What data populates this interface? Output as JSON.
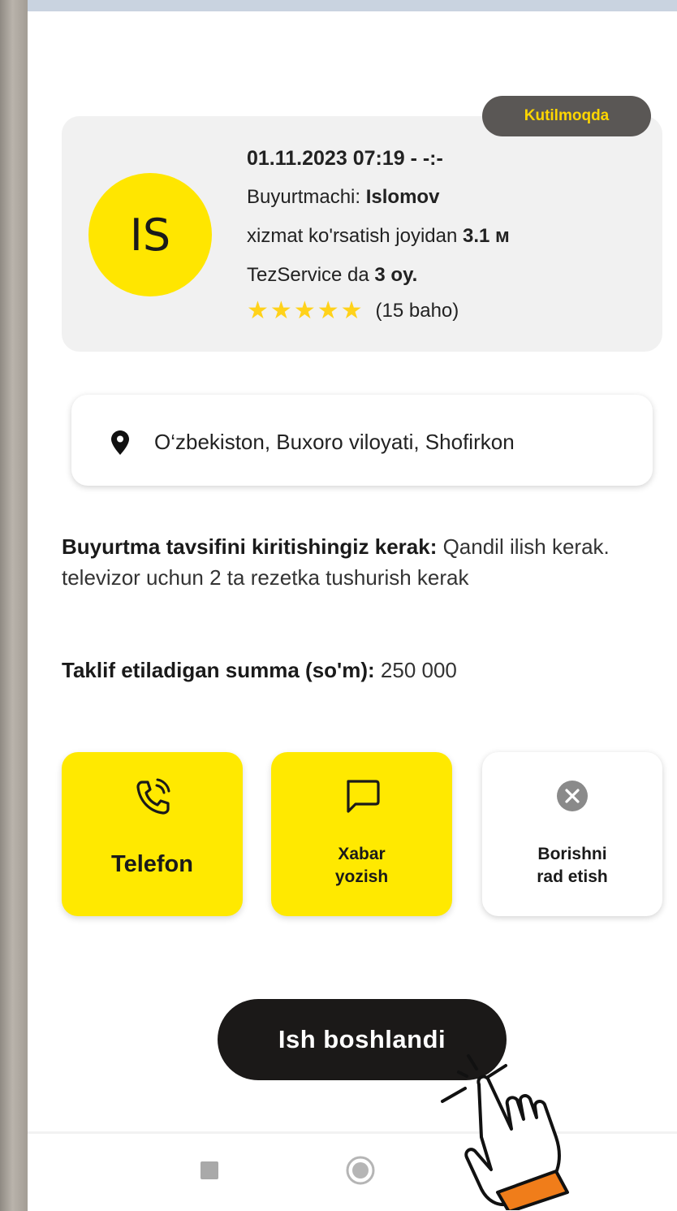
{
  "order": {
    "status": "Kutilmoqda",
    "avatar_initials": "IS",
    "datetime": "01.11.2023 07:19 - -:-",
    "client_label": "Buyurtmachi: ",
    "client_name": "Islomov",
    "distance_label": "xizmat ko'rsatish joyidan ",
    "distance_value": "3.1 м",
    "tenure_label": "TezService da ",
    "tenure_value": "3 oy.",
    "rating_stars": 5,
    "rating_count": "(15 baho)"
  },
  "location": {
    "icon": "map-pin-icon",
    "address": "O‘zbekiston, Buxoro viloyati, Shofirkon"
  },
  "description": {
    "label": "Buyurtma tavsifini kiritishingiz kerak:",
    "text": " Qandil ilish kerak. televizor uchun 2 ta rezetka tushurish kerak"
  },
  "offer": {
    "label": "Taklif etiladigan summa (so'm):",
    "value": " 250 000"
  },
  "actions": {
    "phone_label": "Telefon",
    "message_label_line1": "Xabar",
    "message_label_line2": "yozish",
    "reject_label_line1": "Borishni",
    "reject_label_line2": "rad etish"
  },
  "start_button": "Ish boshlandi",
  "colors": {
    "accent": "#ffe900",
    "badge_bg": "#5a5755",
    "badge_text": "#ffd600",
    "dark_button": "#1b1918",
    "star": "#ffd21a"
  }
}
